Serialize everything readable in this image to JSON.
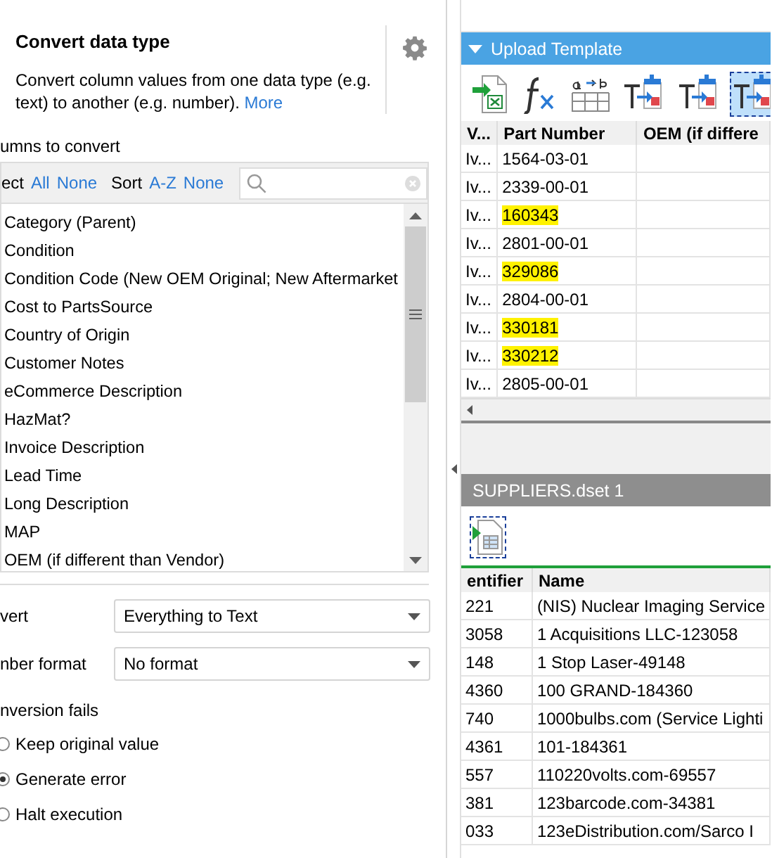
{
  "panel": {
    "title": "Convert data type",
    "description": "Convert column values from one data type (e.g. text) to another (e.g. number).",
    "more_link": "More"
  },
  "columns_section": {
    "label": "umns to convert",
    "select_label": "ect",
    "select_links": [
      "All",
      "None"
    ],
    "sort_label": "Sort",
    "sort_links": [
      "A-Z",
      "None"
    ],
    "items": [
      "Category (Parent)",
      "Condition",
      "Condition Code (New OEM Original; New Aftermarket",
      "Cost to PartsSource",
      "Country of Origin",
      "Customer Notes",
      "eCommerce Description",
      "HazMat?",
      "Invoice Description",
      "Lead Time",
      "Long Description",
      "MAP",
      "OEM (if different than Vendor)"
    ]
  },
  "convert": {
    "label": "vert",
    "value": "Everything to Text"
  },
  "number_format": {
    "label": "nber format",
    "value": "No format"
  },
  "conversion_fails": {
    "label": "nversion fails",
    "options": [
      {
        "label": "Keep original value",
        "selected": false
      },
      {
        "label": "Generate error",
        "selected": true
      },
      {
        "label": "Halt execution",
        "selected": false
      }
    ]
  },
  "upload_template": {
    "title": "Upload Template",
    "expanded": true,
    "toolbar": [
      {
        "kind": "import-excel",
        "selected": false
      },
      {
        "kind": "formula",
        "selected": false
      },
      {
        "kind": "rename",
        "selected": false
      },
      {
        "kind": "text-convert",
        "selected": false
      },
      {
        "kind": "text-convert",
        "selected": false
      },
      {
        "kind": "text-convert",
        "selected": true
      }
    ],
    "columns": [
      "V...",
      "Part Number",
      "OEM (if differe"
    ],
    "rows": [
      {
        "vendor": "Iv...",
        "part_number": "1564-03-01",
        "highlighted": false
      },
      {
        "vendor": "Iv...",
        "part_number": "2339-00-01",
        "highlighted": false
      },
      {
        "vendor": "Iv...",
        "part_number": "160343",
        "highlighted": true
      },
      {
        "vendor": "Iv...",
        "part_number": "2801-00-01",
        "highlighted": false
      },
      {
        "vendor": "Iv...",
        "part_number": "329086",
        "highlighted": true
      },
      {
        "vendor": "Iv...",
        "part_number": "2804-00-01",
        "highlighted": false
      },
      {
        "vendor": "Iv...",
        "part_number": "330181",
        "highlighted": true
      },
      {
        "vendor": "Iv...",
        "part_number": "330212",
        "highlighted": true
      },
      {
        "vendor": "Iv...",
        "part_number": "2805-00-01",
        "highlighted": false
      }
    ]
  },
  "suppliers": {
    "title": "SUPPLIERS.dset 1",
    "toolbar": [
      {
        "kind": "import-sheet",
        "selected": true
      }
    ],
    "columns": [
      "entifier",
      "Name"
    ],
    "rows": [
      [
        "221",
        "(NIS) Nuclear Imaging Service"
      ],
      [
        "3058",
        "1 Acquisitions LLC-123058"
      ],
      [
        "148",
        "1 Stop Laser-49148"
      ],
      [
        "4360",
        "100 GRAND-184360"
      ],
      [
        "740",
        "1000bulbs.com (Service Lighti"
      ],
      [
        "4361",
        "101-184361"
      ],
      [
        "557",
        "110220volts.com-69557"
      ],
      [
        "381",
        "123barcode.com-34381"
      ],
      [
        "033",
        "123eDistribution.com/Sarco I"
      ]
    ]
  }
}
